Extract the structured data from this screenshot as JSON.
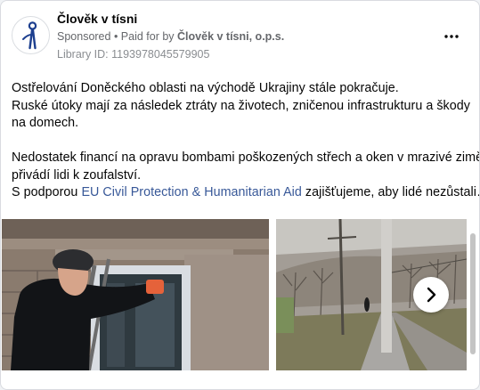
{
  "advertiser": {
    "name": "Člověk v tísni",
    "sponsored_label": "Sponsored",
    "separator": " • ",
    "paid_for_prefix": "Paid for by ",
    "paid_for_name": "Člověk v tísni, o.p.s.",
    "library_id": "Library ID: 1193978045579905"
  },
  "post": {
    "line1": "Ostřelování Doněckého oblasti na východě Ukrajiny stále pokračuje.",
    "line2": "Ruské útoky mají za následek ztráty na životech, zničenou infrastrukturu a škody",
    "line3": "na domech.",
    "line4": "Nedostatek financí na opravu bombami poškozených střech a oken v mrazivé zimě",
    "line5": "přivádí lidi k zoufalství.",
    "line6_prefix": "S podporou ",
    "line6_link": "EU Civil Protection & Humanitarian Aid",
    "line6_suffix": " zajišťujeme, aby lidé nezůstali…"
  },
  "icons": {
    "avatar": "person-logo-icon",
    "more": "more-options-icon",
    "next": "chevron-right-icon"
  },
  "colors": {
    "link": "#385898",
    "secondary_text": "#65676b",
    "logo": "#1d3f8f"
  }
}
